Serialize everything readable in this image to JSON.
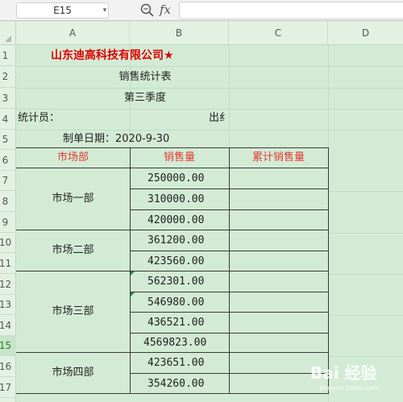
{
  "formula_bar": {
    "cell_ref": "E15",
    "fx_label": "fx",
    "formula": ""
  },
  "columns": [
    "A",
    "B",
    "C",
    "D"
  ],
  "rows": [
    "1",
    "2",
    "3",
    "4",
    "5",
    "6",
    "7",
    "8",
    "9",
    "10",
    "11",
    "12",
    "13",
    "14",
    "15",
    "16",
    "17"
  ],
  "active_row": "15",
  "sheet": {
    "company": "山东迪高科技有限公司★",
    "report_title": "销售统计表",
    "quarter": "第三季度",
    "statistician_label": "统计员：",
    "date_label": "制单日期：2020-9-30",
    "cut_text": "出纟"
  },
  "table": {
    "headers": [
      "市场部",
      "销售量",
      "累计销售量"
    ],
    "groups": [
      {
        "name": "市场一部",
        "values": [
          "250000.00",
          "310000.00",
          "420000.00"
        ]
      },
      {
        "name": "市场二部",
        "values": [
          "361200.00",
          "423560.00"
        ]
      },
      {
        "name": "市场三部",
        "values": [
          "562301.00",
          "546980.00",
          "436521.00",
          "4569823.00"
        ]
      },
      {
        "name": "市场四部",
        "values": [
          "423651.00",
          "354260.00"
        ]
      }
    ]
  },
  "watermark": {
    "text": "Bai 经验",
    "sub": "jingyan.baidu.com"
  },
  "colors": {
    "accent_red": "#e53935",
    "sheet_bg": "#d3ebd5"
  }
}
